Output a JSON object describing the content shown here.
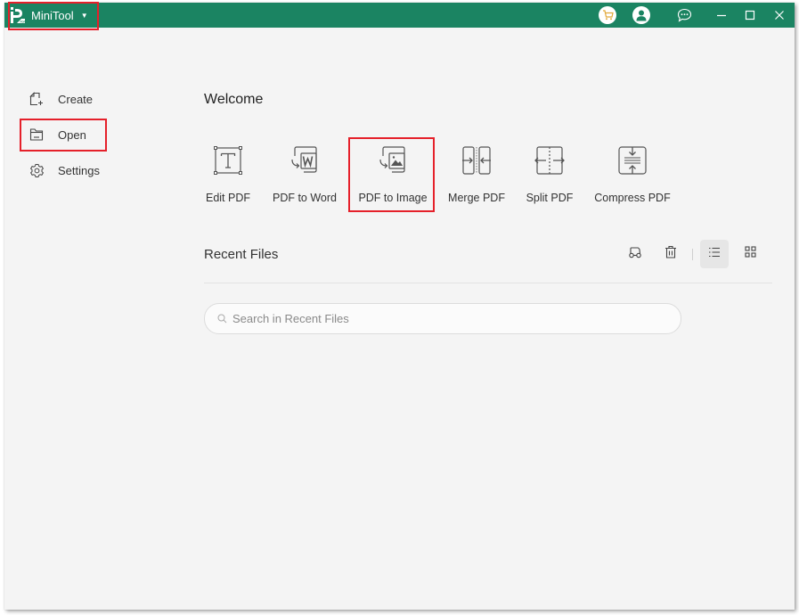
{
  "titlebar": {
    "app_name": "MiniTool",
    "dropdown_icon": "caret-down-icon",
    "right_icons": [
      "cart-icon",
      "user-icon",
      "chat-icon",
      "minimize-icon",
      "maximize-icon",
      "close-icon"
    ],
    "brand_color": "#1b8462"
  },
  "sidebar": {
    "items": [
      {
        "label": "Create",
        "icon": "create-file-icon"
      },
      {
        "label": "Open",
        "icon": "folder-icon"
      },
      {
        "label": "Settings",
        "icon": "gear-icon"
      }
    ]
  },
  "main": {
    "welcome": "Welcome",
    "tools": [
      {
        "label": "Edit PDF",
        "icon": "edit-text-icon"
      },
      {
        "label": "PDF to Word",
        "icon": "pdf-to-word-icon"
      },
      {
        "label": "PDF to Image",
        "icon": "pdf-to-image-icon"
      },
      {
        "label": "Merge PDF",
        "icon": "merge-icon"
      },
      {
        "label": "Split PDF",
        "icon": "split-icon"
      },
      {
        "label": "Compress PDF",
        "icon": "compress-icon"
      }
    ],
    "recent": {
      "title": "Recent Files",
      "actions": [
        "glasses-icon",
        "trash-icon",
        "list-view-icon",
        "grid-view-icon"
      ],
      "search_placeholder": "Search in Recent Files"
    }
  },
  "highlight_color": "#e5202a"
}
